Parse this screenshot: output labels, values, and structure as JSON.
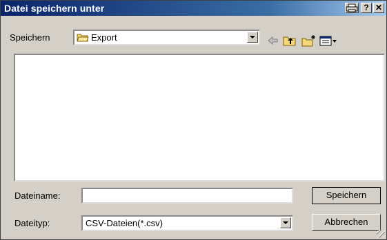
{
  "window": {
    "title": "Datei speichern unter"
  },
  "titlebar_buttons": [
    {
      "name": "print-icon",
      "label": ""
    },
    {
      "name": "help-button",
      "label": "?"
    },
    {
      "name": "close-button",
      "label": "✕"
    }
  ],
  "location": {
    "label": "Speichern",
    "folder_icon": "folder-icon",
    "value": "Export"
  },
  "toolbar": {
    "back_icon": "back-arrow-icon",
    "up_icon": "up-folder-icon",
    "new_folder_icon": "new-folder-icon",
    "view_icon": "view-menu-icon"
  },
  "filename": {
    "label": "Dateiname:",
    "value": ""
  },
  "filetype": {
    "label": "Dateityp:",
    "value": "CSV-Dateien(*.csv)"
  },
  "buttons": {
    "save": "Speichern",
    "cancel": "Abbrechen"
  },
  "colors": {
    "titlebar": "#0a246a",
    "face": "#d4d0c8"
  }
}
